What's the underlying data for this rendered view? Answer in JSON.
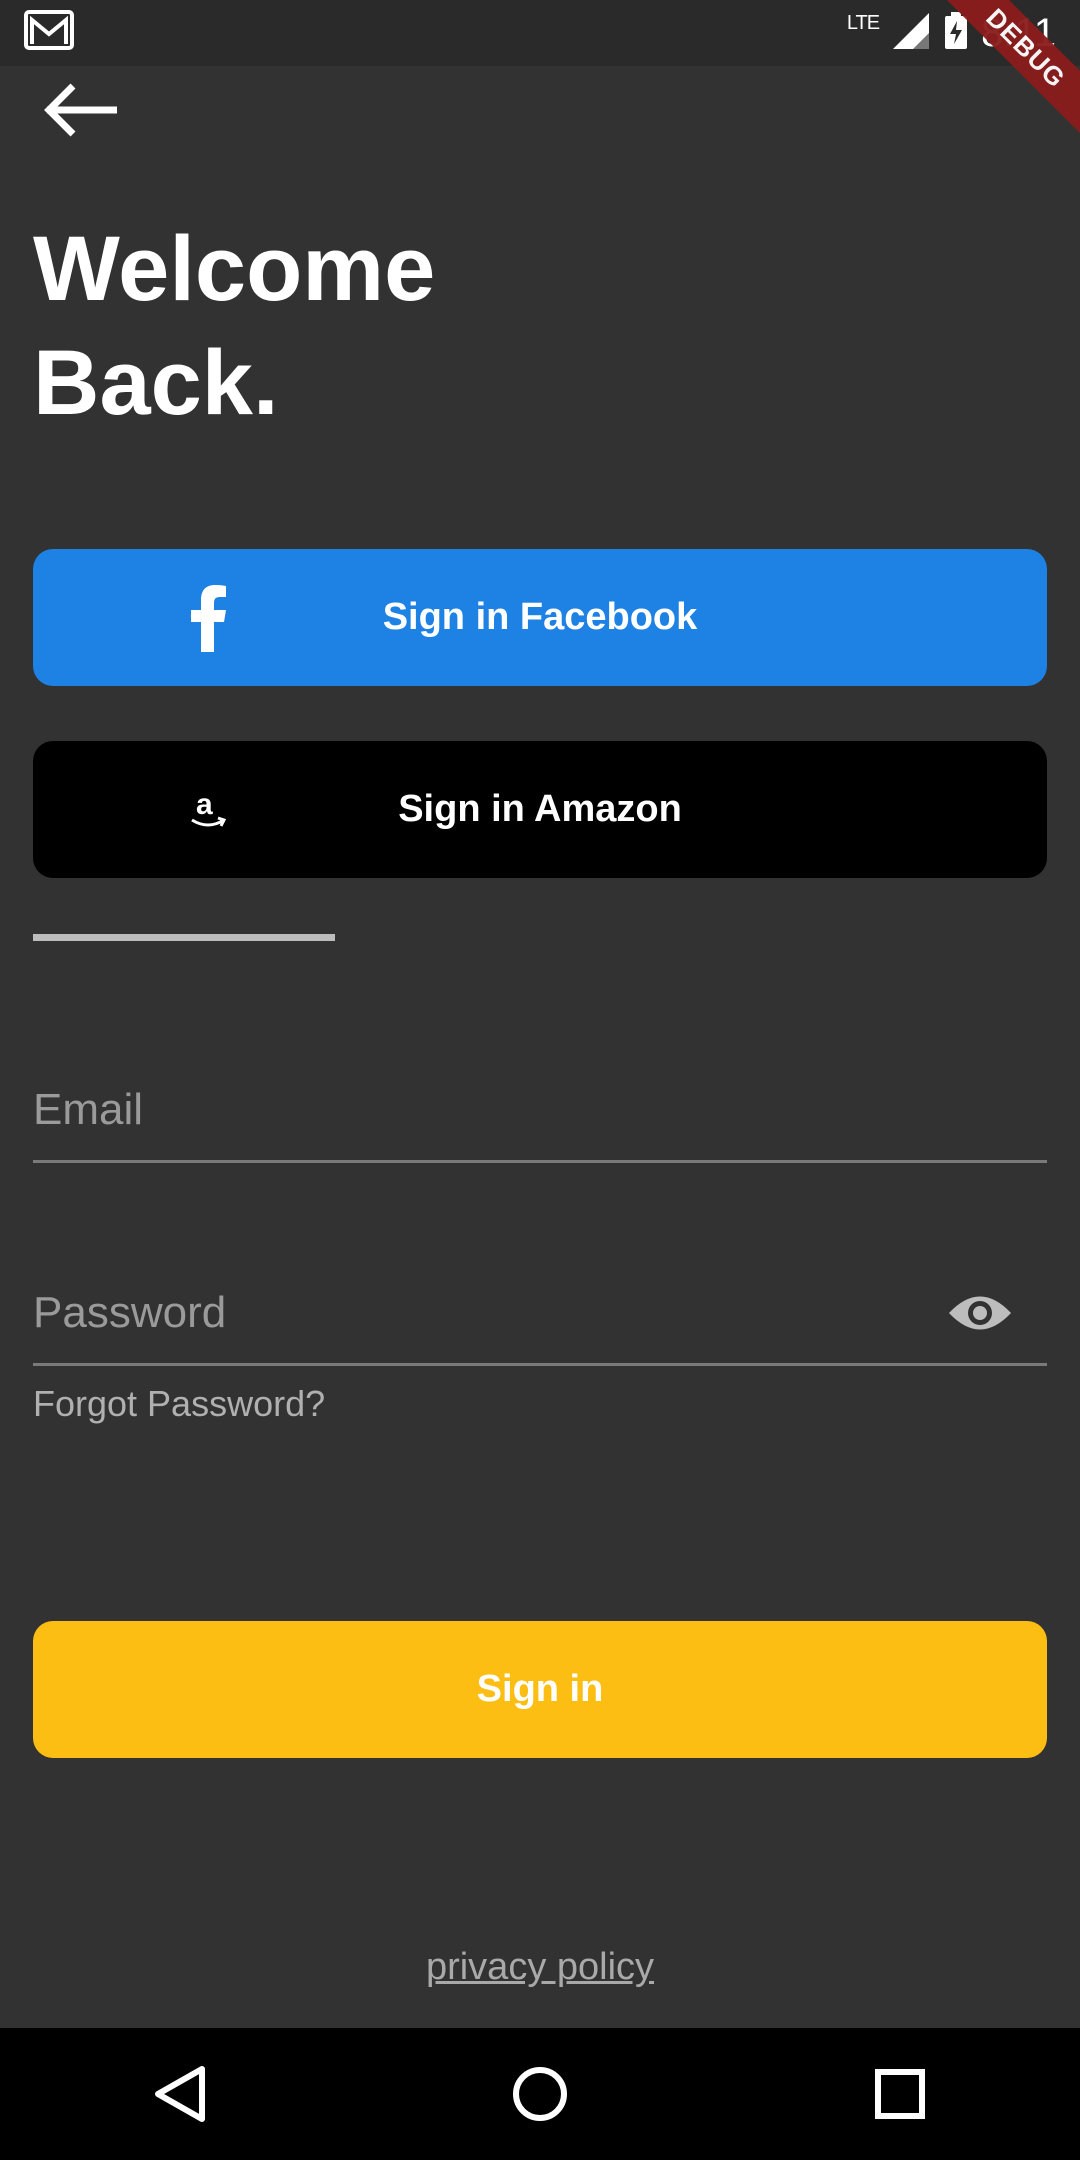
{
  "status_bar": {
    "network": "LTE",
    "time": "8:11"
  },
  "debug_banner": "DEBUG",
  "header": {
    "title_line1": "Welcome",
    "title_line2": "Back."
  },
  "social": {
    "facebook_label": "Sign in Facebook",
    "amazon_label": "Sign in Amazon",
    "facebook_color": "#1e82e4",
    "amazon_color": "#000000"
  },
  "form": {
    "email_placeholder": "Email",
    "password_placeholder": "Password",
    "forgot_label": "Forgot Password?"
  },
  "actions": {
    "signin_label": "Sign in",
    "signin_color": "#fdbe13"
  },
  "footer": {
    "privacy_label": "privacy policy"
  },
  "icons": {
    "back": "arrow-left-icon",
    "facebook": "facebook-icon",
    "amazon": "amazon-icon",
    "visibility": "eye-icon",
    "nav_back": "triangle-back-icon",
    "nav_home": "circle-home-icon",
    "nav_recents": "square-recents-icon"
  }
}
